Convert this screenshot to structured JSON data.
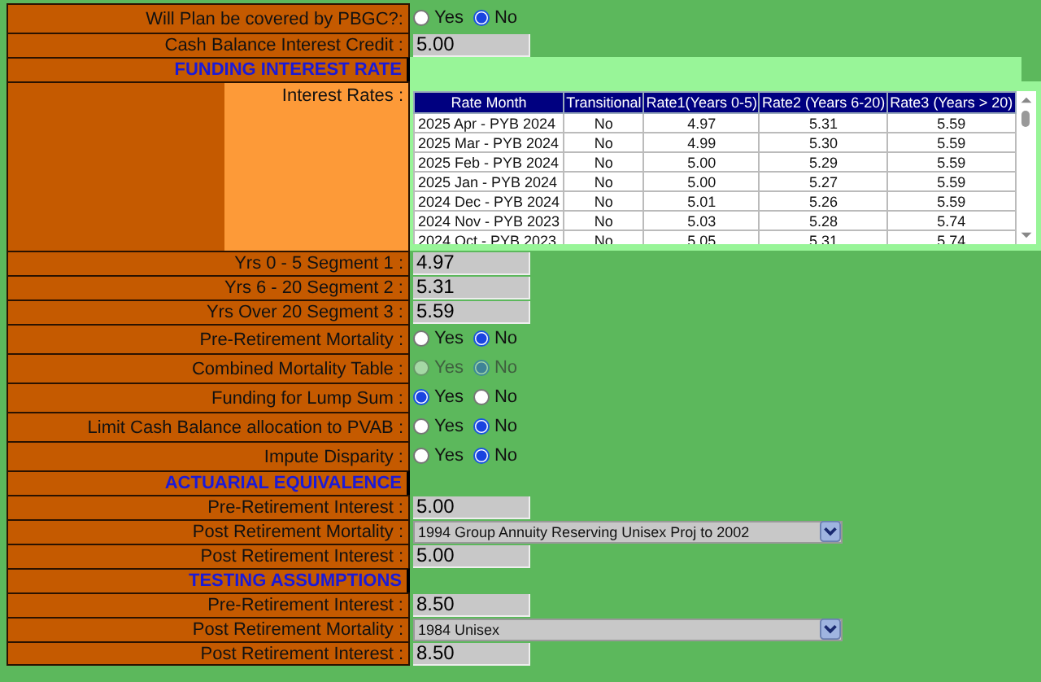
{
  "rows": [
    {
      "kind": "radio",
      "label": "Will Plan be covered by PBGC?:",
      "disabled": false,
      "options": [
        {
          "label": "Yes",
          "selected": false
        },
        {
          "label": "No",
          "selected": true
        }
      ]
    },
    {
      "kind": "input",
      "label": "Cash Balance Interest Credit :",
      "value": "5.00"
    },
    {
      "kind": "header",
      "label": "FUNDING INTEREST RATE",
      "highlighted": true
    },
    {
      "kind": "table",
      "label": "Interest Rates :",
      "columns": [
        "Rate Month",
        "Transitional",
        "Rate1(Years 0-5)",
        "Rate2 (Years 6-20)",
        "Rate3 (Years > 20)"
      ],
      "rows": [
        [
          "2025 Apr - PYB 2024",
          "No",
          "4.97",
          "5.31",
          "5.59"
        ],
        [
          "2025 Mar - PYB 2024",
          "No",
          "4.99",
          "5.30",
          "5.59"
        ],
        [
          "2025 Feb - PYB 2024",
          "No",
          "5.00",
          "5.29",
          "5.59"
        ],
        [
          "2025 Jan - PYB 2024",
          "No",
          "5.00",
          "5.27",
          "5.59"
        ],
        [
          "2024 Dec - PYB 2024",
          "No",
          "5.01",
          "5.26",
          "5.59"
        ],
        [
          "2024 Nov - PYB 2023",
          "No",
          "5.03",
          "5.28",
          "5.74"
        ],
        [
          "2024 Oct - PYB 2023",
          "No",
          "5.05",
          "5.31",
          "5.74"
        ]
      ]
    },
    {
      "kind": "input",
      "label": "Yrs 0 - 5 Segment 1 :",
      "value": "4.97"
    },
    {
      "kind": "input",
      "label": "Yrs 6 - 20 Segment 2 :",
      "value": "5.31"
    },
    {
      "kind": "input",
      "label": "Yrs Over 20 Segment 3 :",
      "value": "5.59"
    },
    {
      "kind": "radio",
      "label": "Pre-Retirement Mortality :",
      "disabled": false,
      "options": [
        {
          "label": "Yes",
          "selected": false
        },
        {
          "label": "No",
          "selected": true
        }
      ]
    },
    {
      "kind": "radio",
      "label": "Combined Mortality Table :",
      "disabled": true,
      "options": [
        {
          "label": "Yes",
          "selected": false
        },
        {
          "label": "No",
          "selected": true
        }
      ]
    },
    {
      "kind": "radio",
      "label": "Funding for Lump Sum :",
      "disabled": false,
      "options": [
        {
          "label": "Yes",
          "selected": true
        },
        {
          "label": "No",
          "selected": false
        }
      ]
    },
    {
      "kind": "radio",
      "label": "Limit Cash Balance allocation to PVAB :",
      "disabled": false,
      "options": [
        {
          "label": "Yes",
          "selected": false
        },
        {
          "label": "No",
          "selected": true
        }
      ]
    },
    {
      "kind": "radio",
      "label": "Impute Disparity :",
      "disabled": false,
      "options": [
        {
          "label": "Yes",
          "selected": false
        },
        {
          "label": "No",
          "selected": true
        }
      ]
    },
    {
      "kind": "header",
      "label": "ACTUARIAL EQUIVALENCE",
      "highlighted": false
    },
    {
      "kind": "input",
      "label": "Pre-Retirement Interest :",
      "value": "5.00"
    },
    {
      "kind": "select",
      "label": "Post Retirement Mortality :",
      "value": "1994 Group Annuity Reserving Unisex Proj to 2002"
    },
    {
      "kind": "input",
      "label": "Post Retirement Interest :",
      "value": "5.00"
    },
    {
      "kind": "header",
      "label": "TESTING ASSUMPTIONS",
      "highlighted": false
    },
    {
      "kind": "input",
      "label": "Pre-Retirement Interest :",
      "value": "8.50"
    },
    {
      "kind": "select",
      "label": "Post Retirement Mortality :",
      "value": "1984 Unisex"
    },
    {
      "kind": "input",
      "label": "Post Retirement Interest :",
      "value": "8.50"
    }
  ]
}
